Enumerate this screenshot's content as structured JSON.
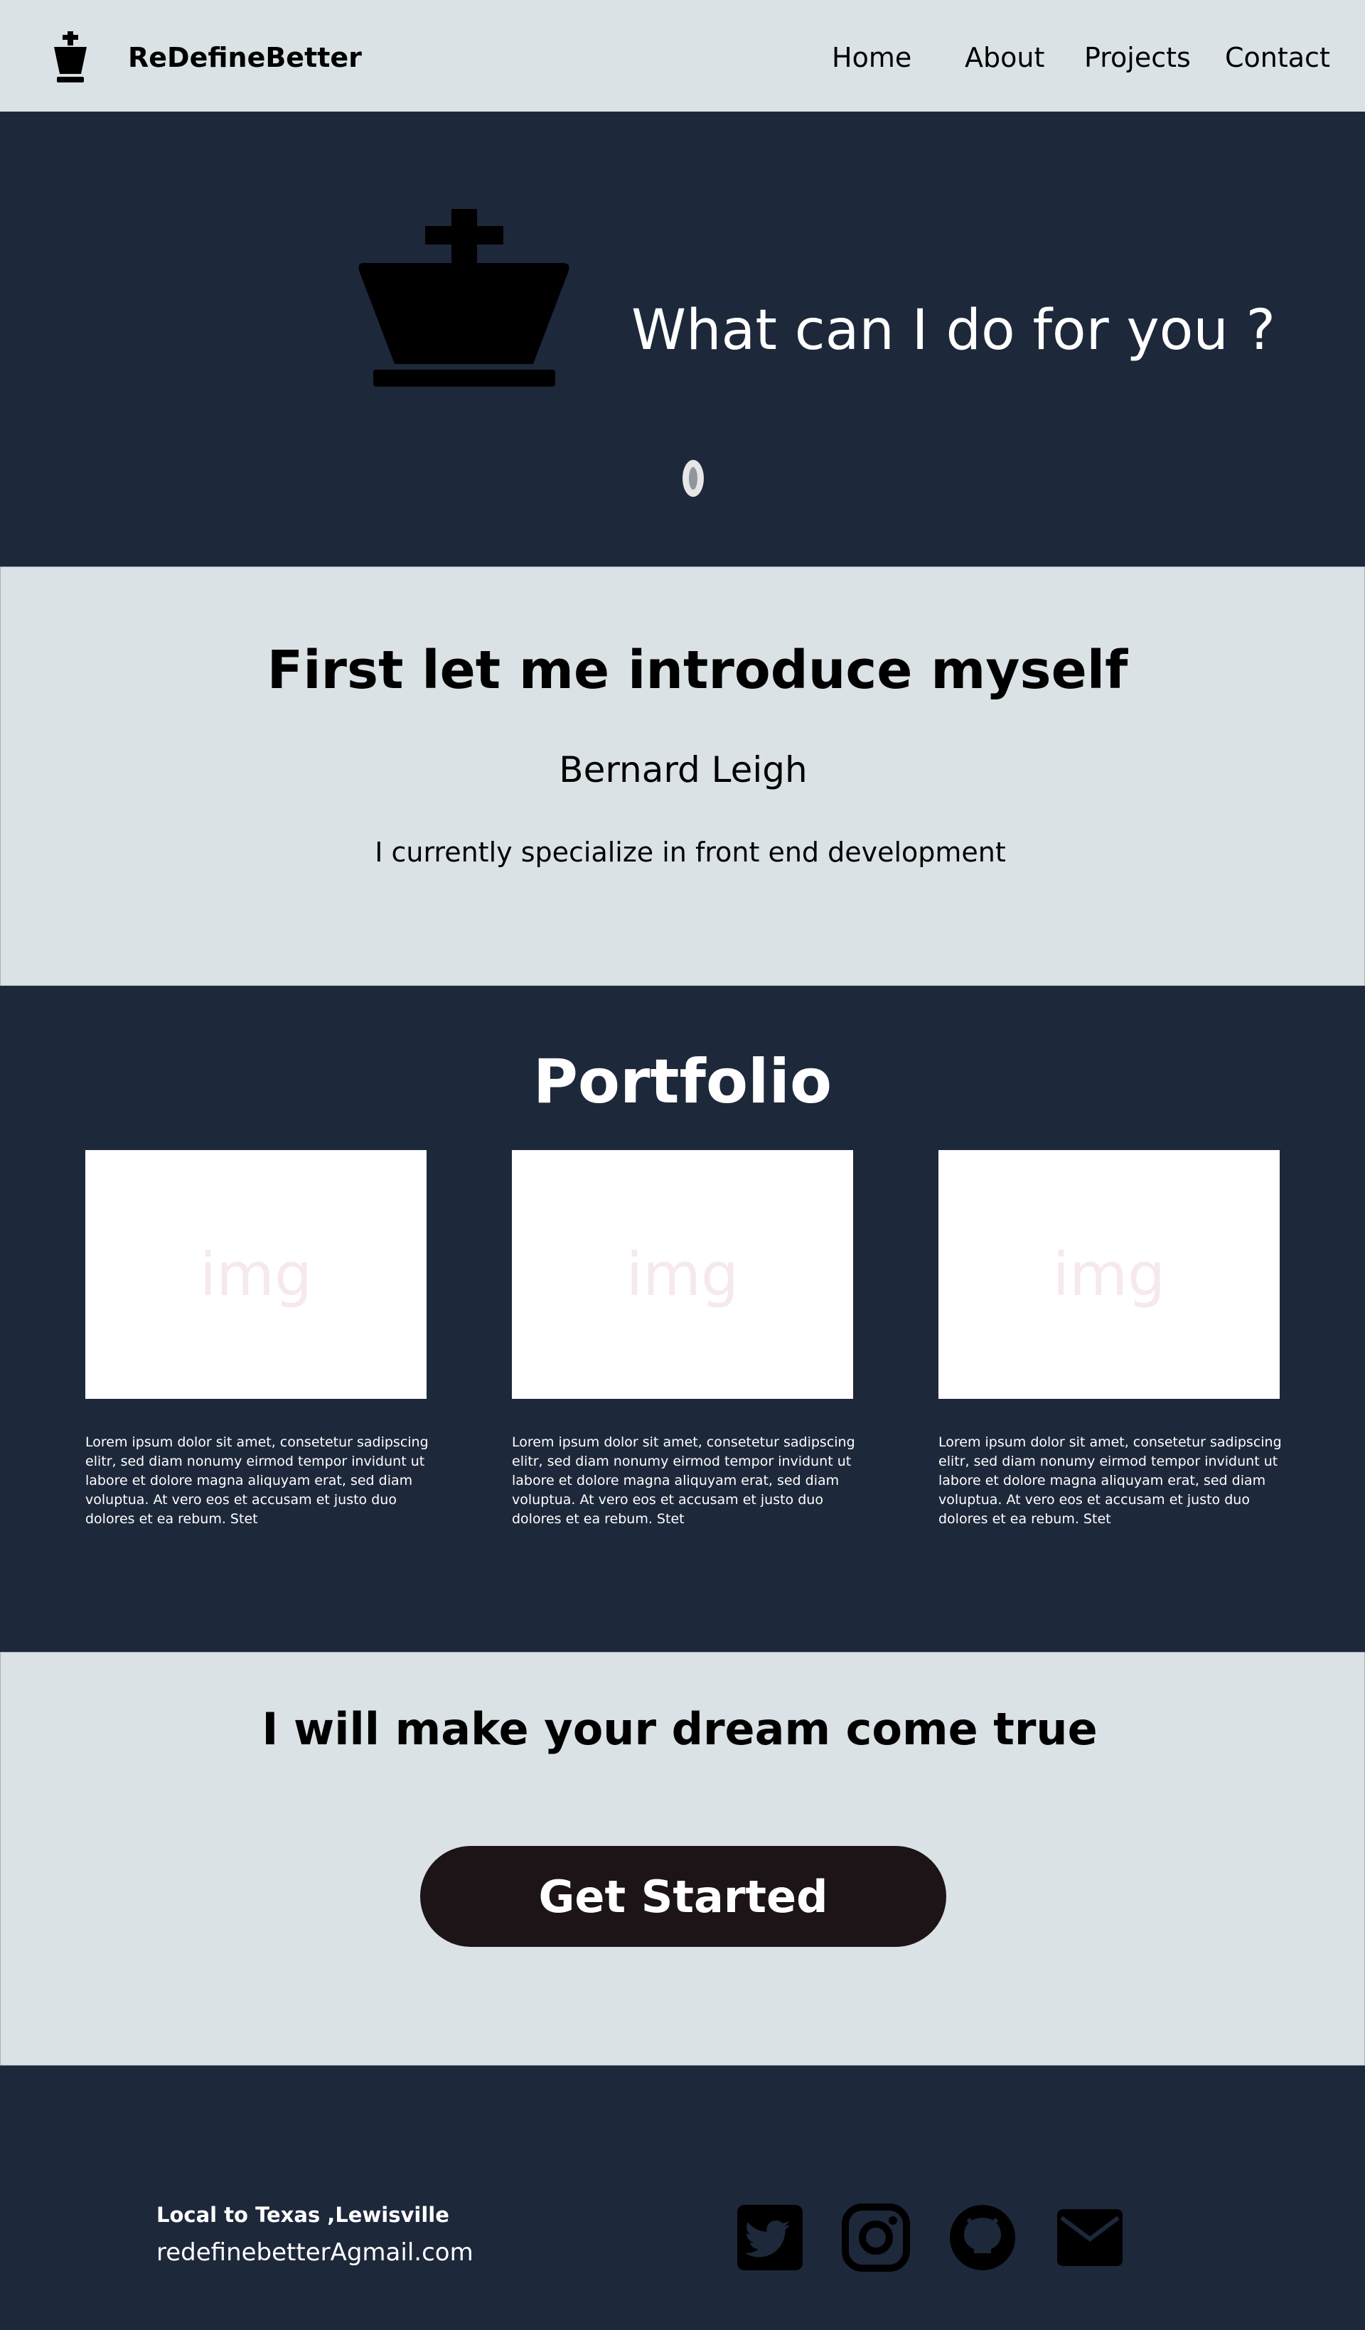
{
  "header": {
    "brand": "ReDefineBetter",
    "logo_icon": "chess-king-icon",
    "nav": {
      "home": "Home",
      "about": "About",
      "projects": "Projects",
      "contact": "Contact"
    }
  },
  "hero": {
    "icon": "chess-king-icon",
    "title": "What can I do for you ?",
    "scroll_icon": "scroll-mouse-icon"
  },
  "intro": {
    "title": "First let me introduce myself",
    "name": "Bernard Leigh",
    "text": "I currently specialize in front end development"
  },
  "portfolio": {
    "title": "Portfolio",
    "cards": [
      {
        "img_label": "img",
        "text": "Lorem ipsum dolor sit amet, consetetur sadipscing elitr, sed diam nonumy eirmod tempor invidunt ut labore et dolore magna aliquyam erat, sed diam voluptua. At vero eos et accusam et justo duo dolores et ea rebum. Stet"
      },
      {
        "img_label": "img",
        "text": "Lorem ipsum dolor sit amet, consetetur sadipscing elitr, sed diam nonumy eirmod tempor invidunt ut labore et dolore magna aliquyam erat, sed diam voluptua. At vero eos et accusam et justo duo dolores et ea rebum. Stet"
      },
      {
        "img_label": "img",
        "text": "Lorem ipsum dolor sit amet, consetetur sadipscing elitr, sed diam nonumy eirmod tempor invidunt ut labore et dolore magna aliquyam erat, sed diam voluptua. At vero eos et accusam et justo duo dolores et ea rebum. Stet"
      }
    ]
  },
  "cta": {
    "title": "I will make your dream come true",
    "button": "Get Started"
  },
  "footer": {
    "location": "Local to Texas ,Lewisville",
    "email": "redefinebetterAgmail.com",
    "social_icons": [
      "twitter-icon",
      "instagram-icon",
      "github-icon",
      "mail-icon"
    ]
  },
  "colors": {
    "light_bg": "#dae2e6",
    "dark_bg": "#1e283b",
    "button_bg": "#1c1416",
    "text_dark": "#000000",
    "text_light": "#ffffff"
  }
}
